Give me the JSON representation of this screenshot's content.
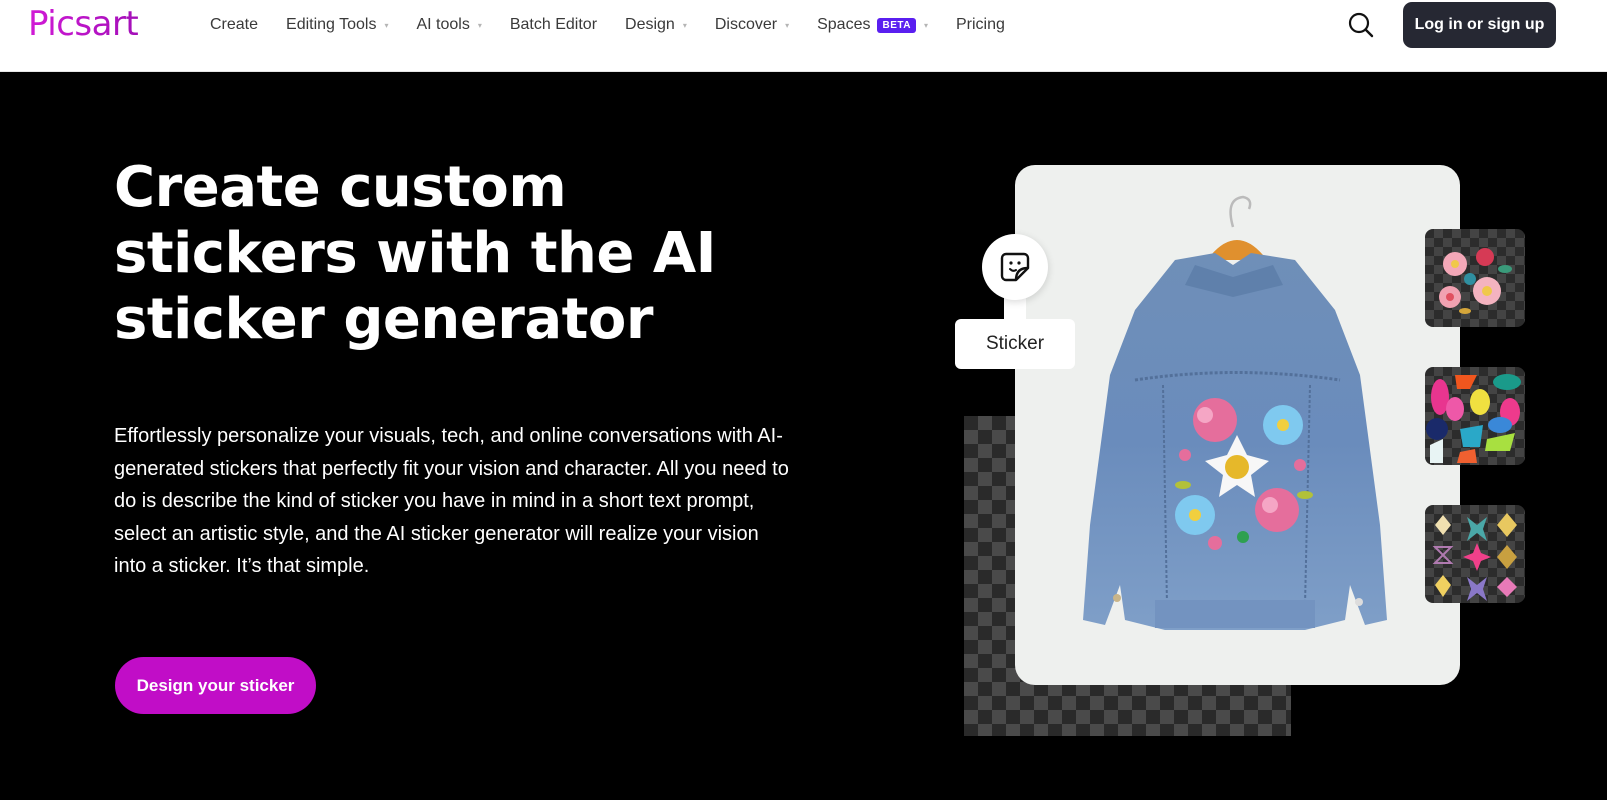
{
  "header": {
    "logo": "Picsart",
    "nav": [
      {
        "label": "Create",
        "dropdown": false
      },
      {
        "label": "Editing Tools",
        "dropdown": true
      },
      {
        "label": "AI tools",
        "dropdown": true
      },
      {
        "label": "Batch Editor",
        "dropdown": false
      },
      {
        "label": "Design",
        "dropdown": true
      },
      {
        "label": "Discover",
        "dropdown": true
      },
      {
        "label": "Spaces",
        "dropdown": true,
        "badge": "BETA"
      },
      {
        "label": "Pricing",
        "dropdown": false
      }
    ],
    "search_icon": "search-icon",
    "login_label": "Log in or sign up"
  },
  "hero": {
    "title": "Create custom stickers with the AI sticker generator",
    "description": "Effortlessly personalize your visuals, tech, and online conversations with AI-generated stickers that perfectly fit your vision and character. All you need to do is describe the kind of sticker you have in mind in a short text prompt, select an artistic style, and the AI sticker generator will realize your vision into a sticker. It’s that simple.",
    "cta_label": "Design your sticker"
  },
  "visual": {
    "badge_icon": "sticker-icon",
    "badge_label": "Sticker",
    "main_image": "embroidered denim jacket on hanger",
    "thumbnails": [
      "floral embroidery sticker",
      "colorful gem sticker",
      "ornament pattern sticker"
    ]
  },
  "colors": {
    "brand": "#c10dc7",
    "login_bg": "#262833",
    "beta_bg": "#5a1ff0",
    "hero_bg": "#000000"
  },
  "dropdown_caret": "▾"
}
